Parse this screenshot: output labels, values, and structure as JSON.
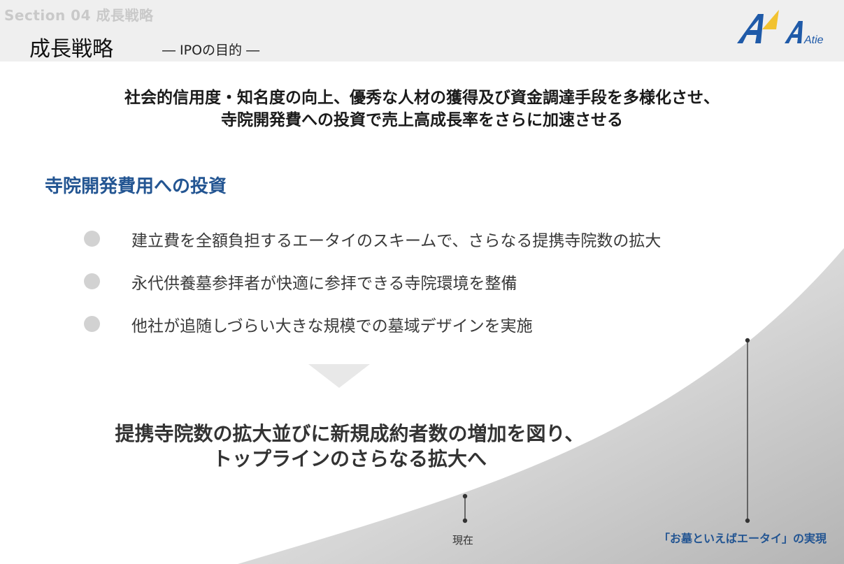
{
  "header": {
    "section_label": "Section 04  成長戦略",
    "title": "成長戦略",
    "subtitle": "―  IPOの目的  ―",
    "logo_text": "Atie"
  },
  "lead": {
    "line1": "社会的信用度・知名度の向上、優秀な人材の獲得及び資金調達手段を多様化させ、",
    "line2": "寺院開発費への投資で売上高成長率をさらに加速させる"
  },
  "investment": {
    "heading": "寺院開発費用への投資",
    "items": [
      "建立費を全額負担するエータイのスキームで、さらなる提携寺院数の拡大",
      "永代供養墓参拝者が快適に参拝できる寺院環境を整備",
      "他社が追随しづらい大きな規模での墓域デザインを実施"
    ]
  },
  "conclusion": {
    "line1": "提携寺院数の拡大並びに新規成約者数の増加を図り、",
    "line2": "トップラインのさらなる拡大へ"
  },
  "growth_curve": {
    "marker_now": "現在",
    "marker_goal": "「お墓といえばエータイ」の実現"
  },
  "colors": {
    "accent_blue": "#235592",
    "logo_blue": "#1f5aa8",
    "logo_yellow": "#f2c230",
    "header_bg": "#efefef"
  }
}
